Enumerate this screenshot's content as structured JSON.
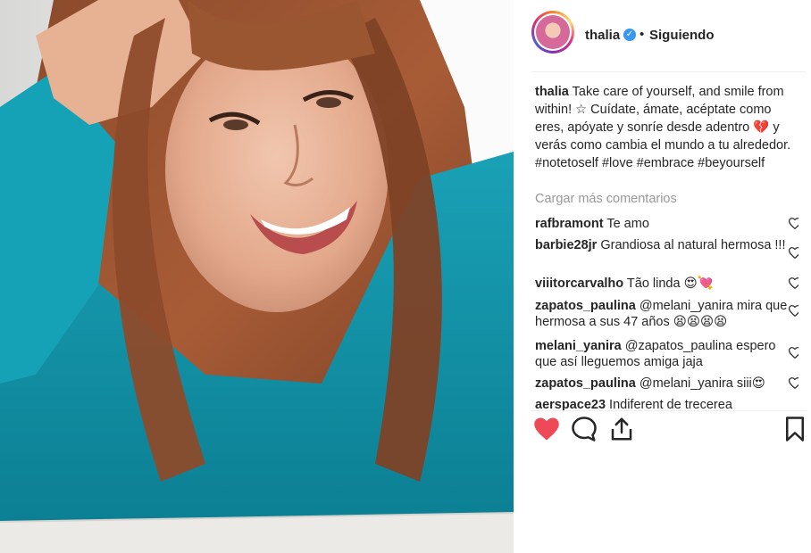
{
  "account": {
    "username": "thalia",
    "separator": "•",
    "follow_state": "Siguiendo"
  },
  "caption": {
    "author": "thalia",
    "text_1": " Take care of yourself, and smile from within! ☆ Cuídate, ámate, acéptate como eres, apóyate y sonríe desde adentro ",
    "emoji": "💔",
    "text_2": " y verás como cambia el mundo a tu alrededor. #notetoself #love #embrace #beyourself"
  },
  "load_more": "Cargar más comentarios",
  "comments": [
    {
      "user": "rafbramont",
      "text": "Te amo"
    },
    {
      "user": "barbie28jr",
      "text": "Grandiosa al natural hermosa !!!"
    },
    {
      "user": "viiitorcarvalho",
      "text": "Tão linda 😍💘"
    },
    {
      "user": "zapatos_paulina",
      "text": "@melani_yanira mira que hermosa a sus 47 años 😫😫😫😫"
    },
    {
      "user": "melani_yanira",
      "text": "@zapatos_paulina espero que así lleguemos amiga jaja"
    },
    {
      "user": "zapatos_paulina",
      "text": "@melani_yanira siii😍"
    },
    {
      "user": "aerspace23",
      "text": "Indiferent de trecerea"
    }
  ],
  "colors": {
    "like_red": "#ed4956",
    "verified_blue": "#3897f0",
    "muted_text": "#999999",
    "text": "#262626"
  },
  "icons": {
    "like": "heart-filled-icon",
    "comment": "comment-bubble-icon",
    "share": "share-upload-icon",
    "save": "bookmark-icon",
    "comment_like": "heart-outline-icon",
    "verified": "verified-badge-icon"
  }
}
